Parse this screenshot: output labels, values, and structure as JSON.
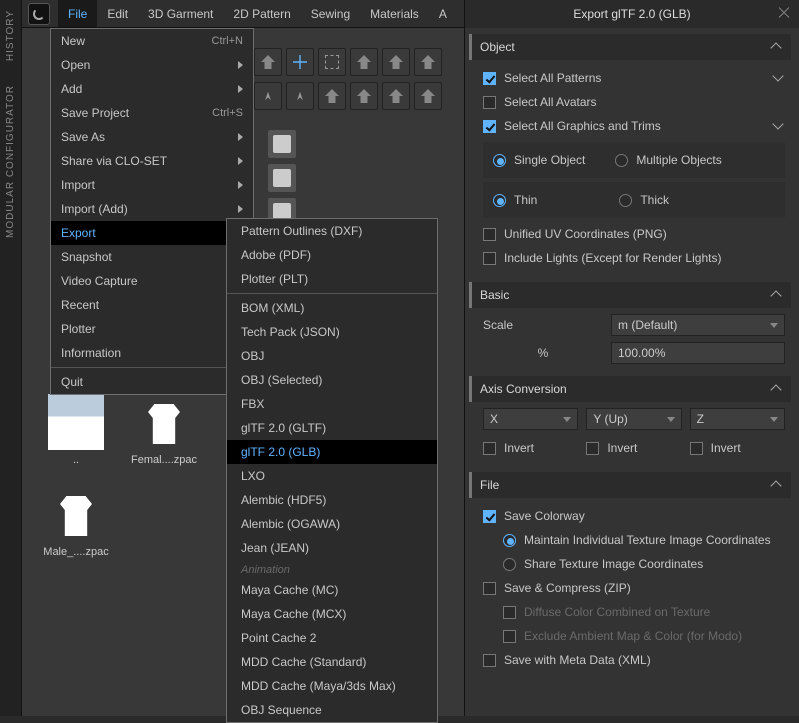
{
  "vtabs": [
    "HISTORY",
    "MODULAR CONFIGURATOR"
  ],
  "menubar": [
    "File",
    "Edit",
    "3D Garment",
    "2D Pattern",
    "Sewing",
    "Materials",
    "A"
  ],
  "file_menu": [
    {
      "label": "New",
      "shortcut": "Ctrl+N"
    },
    {
      "label": "Open",
      "sub": true
    },
    {
      "label": "Add",
      "sub": true
    },
    {
      "label": "Save Project",
      "shortcut": "Ctrl+S"
    },
    {
      "label": "Save As",
      "sub": true
    },
    {
      "label": "Share via CLO-SET",
      "sub": true
    },
    {
      "label": "Import",
      "sub": true
    },
    {
      "label": "Import (Add)",
      "sub": true
    },
    {
      "label": "Export",
      "sub": true,
      "hover": true
    },
    {
      "label": "Snapshot",
      "sub": true
    },
    {
      "label": "Video Capture",
      "sub": true
    },
    {
      "label": "Recent",
      "sub": true
    },
    {
      "label": "Plotter"
    },
    {
      "label": "Information",
      "sub": true
    },
    {
      "sep": true
    },
    {
      "label": "Quit"
    }
  ],
  "export_menu": [
    {
      "label": "Pattern Outlines (DXF)"
    },
    {
      "label": "Adobe (PDF)"
    },
    {
      "label": "Plotter (PLT)"
    },
    {
      "sep": true
    },
    {
      "label": "BOM (XML)"
    },
    {
      "label": "Tech Pack (JSON)"
    },
    {
      "label": "OBJ"
    },
    {
      "label": "OBJ (Selected)"
    },
    {
      "label": "FBX"
    },
    {
      "label": "glTF 2.0 (GLTF)"
    },
    {
      "label": "glTF 2.0 (GLB)",
      "selected": true
    },
    {
      "label": "LXO"
    },
    {
      "label": "Alembic (HDF5)"
    },
    {
      "label": "Alembic (OGAWA)"
    },
    {
      "label": "Jean (JEAN)"
    },
    {
      "head": "Animation"
    },
    {
      "label": "Maya Cache (MC)"
    },
    {
      "label": "Maya Cache (MCX)"
    },
    {
      "label": "Point Cache 2"
    },
    {
      "label": "MDD Cache (Standard)"
    },
    {
      "label": "MDD Cache (Maya/3ds Max)"
    },
    {
      "label": "OBJ Sequence"
    }
  ],
  "assets": [
    {
      "label": "..",
      "kind": "pants"
    },
    {
      "label": "Femal....zpac",
      "kind": "holder"
    },
    {
      "label": "Male_....zpac",
      "kind": "holder"
    }
  ],
  "panel": {
    "title": "Export glTF 2.0 (GLB)",
    "object": {
      "heading": "Object",
      "select_all_patterns": "Select All Patterns",
      "select_all_avatars": "Select All Avatars",
      "select_all_graphics": "Select All Graphics and Trims",
      "single_object": "Single Object",
      "multiple_objects": "Multiple Objects",
      "thin": "Thin",
      "thick": "Thick",
      "unified_uv": "Unified UV Coordinates (PNG)",
      "include_lights": "Include Lights (Except for Render Lights)"
    },
    "basic": {
      "heading": "Basic",
      "scale_lbl": "Scale",
      "scale_val": "m (Default)",
      "pct_lbl": "%",
      "pct_val": "100.00%"
    },
    "axis": {
      "heading": "Axis Conversion",
      "x": "X",
      "y": "Y (Up)",
      "z": "Z",
      "invert": "Invert"
    },
    "file": {
      "heading": "File",
      "save_colorway": "Save Colorway",
      "maintain": "Maintain Individual Texture Image Coordinates",
      "share": "Share Texture Image Coordinates",
      "save_compress": "Save & Compress (ZIP)",
      "diffuse": "Diffuse Color Combined on Texture",
      "exclude": "Exclude Ambient Map & Color (for Modo)",
      "save_meta": "Save with Meta Data (XML)"
    }
  }
}
